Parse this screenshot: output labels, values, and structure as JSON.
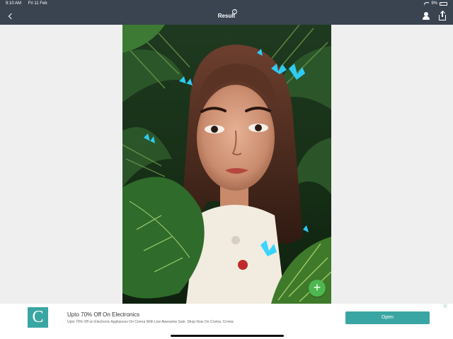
{
  "status_bar": {
    "time": "9:10 AM",
    "date": "Fri 11 Feb",
    "battery": "9%"
  },
  "nav": {
    "title": "Result",
    "info_glyph": "?",
    "icons": [
      "back-chevron-icon",
      "help-icon",
      "profile-icon",
      "share-icon"
    ]
  },
  "result_image": {
    "description_icon": "cartoon-portrait-image",
    "fab_glyph": "+"
  },
  "ad": {
    "logo_letter": "C",
    "title": "Upto 70% Off On Electronics",
    "description": "Upto 70% Off on Electronic Appliances On Croma With Live Awesome Sale. Shop Now On Croma. Croma",
    "button_label": "Open",
    "choices_glyph": "ⓧ"
  },
  "colors": {
    "header": "#3a4350",
    "accent": "#3aa6a3",
    "fab": "#4cb84f",
    "background": "#efefef"
  }
}
